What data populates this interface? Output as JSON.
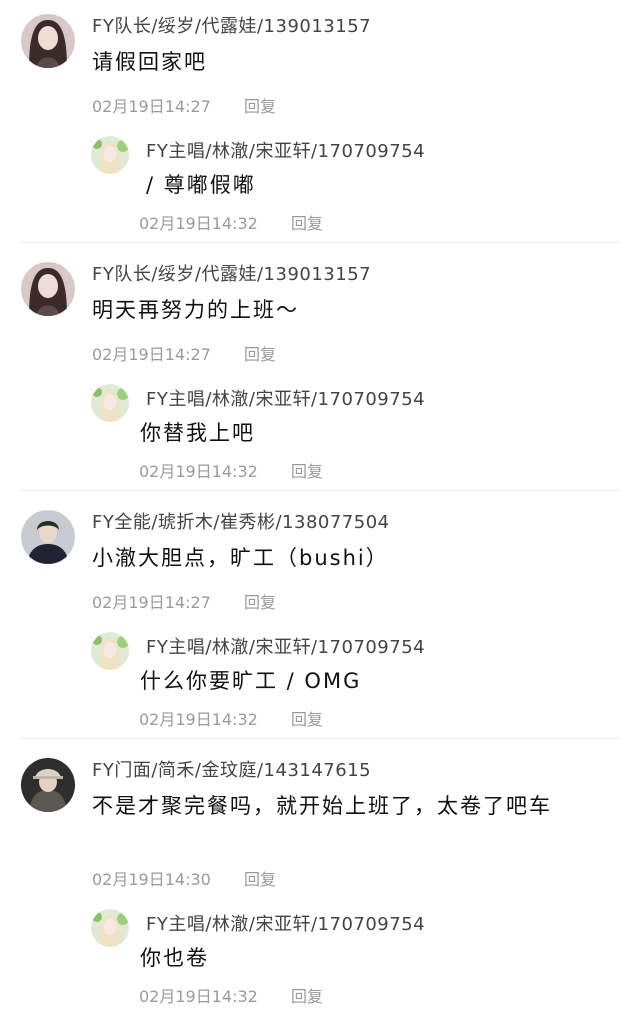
{
  "threads": [
    {
      "comment": {
        "author": "FY队长/绥岁/代露娃/139013157",
        "text": "请假回家吧",
        "time": "02月19日14:27",
        "reply_label": "回复"
      },
      "reply": {
        "author": "FY主唱/林澈/宋亚轩/170709754",
        "text": "/ 尊嘟假嘟",
        "time": "02月19日14:32",
        "reply_label": "回复"
      }
    },
    {
      "comment": {
        "author": "FY队长/绥岁/代露娃/139013157",
        "text": "明天再努力的上班～",
        "time": "02月19日14:27",
        "reply_label": "回复"
      },
      "reply": {
        "author": "FY主唱/林澈/宋亚轩/170709754",
        "text": "你替我上吧",
        "time": "02月19日14:32",
        "reply_label": "回复"
      }
    },
    {
      "comment": {
        "author": "FY全能/琥折木/崔秀彬/138077504",
        "text": "小澈大胆点，旷工（bushi）",
        "time": "02月19日14:27",
        "reply_label": "回复"
      },
      "reply": {
        "author": "FY主唱/林澈/宋亚轩/170709754",
        "text": "什么你要旷工 / OMG",
        "time": "02月19日14:32",
        "reply_label": "回复"
      }
    },
    {
      "comment": {
        "author": "FY门面/简禾/金玟庭/143147615",
        "text": "不是才聚完餐吗，就开始上班了，太卷了吧车",
        "time": "02月19日14:30",
        "reply_label": "回复"
      },
      "reply": {
        "author": "FY主唱/林澈/宋亚轩/170709754",
        "text": "你也卷",
        "time": "02月19日14:32",
        "reply_label": "回复"
      }
    }
  ],
  "avatars": {
    "captain": "avatar-girl-dark-hair-icon",
    "vocal": "avatar-girl-blonde-flowers-icon",
    "allround": "avatar-boy-dark-jacket-icon",
    "visual": "avatar-girl-cap-icon"
  }
}
